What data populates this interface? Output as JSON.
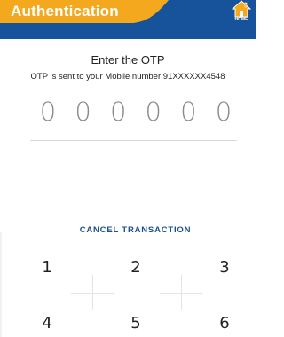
{
  "header": {
    "title": "Authentication",
    "home_label": "HOME",
    "colors": {
      "primary": "#17539b",
      "accent": "#f4a81d"
    }
  },
  "otp": {
    "title": "Enter the OTP",
    "message": "OTP is sent to your Mobile number 91XXXXXX4548",
    "digits": [
      "0",
      "0",
      "0",
      "0",
      "0",
      "0"
    ]
  },
  "actions": {
    "cancel_label": "CANCEL TRANSACTION"
  },
  "keypad": {
    "keys": [
      "1",
      "2",
      "3",
      "4",
      "5",
      "6"
    ]
  }
}
